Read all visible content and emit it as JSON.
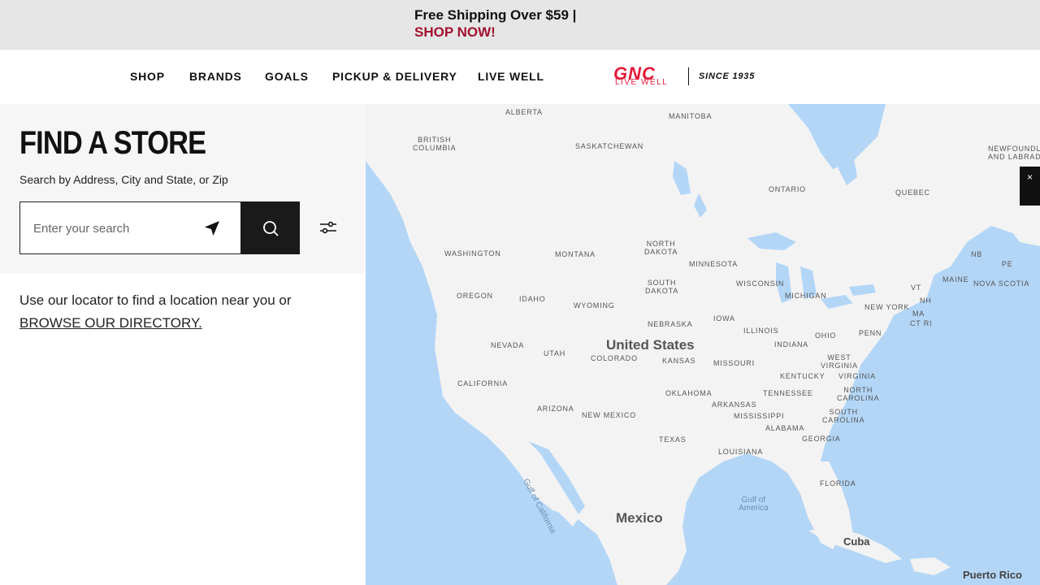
{
  "promo": {
    "line1": "Free Shipping Over $59 |",
    "line2": "SHOP NOW!"
  },
  "nav": {
    "items": [
      "SHOP",
      "BRANDS",
      "GOALS",
      "PICKUP & DELIVERY",
      "LIVE WELL"
    ]
  },
  "logo": {
    "brand": "GNC",
    "tagline": "LIVE WELL",
    "since": "SINCE 1935"
  },
  "find_store": {
    "title": "FIND A STORE",
    "subtitle": "Search by Address, City and State, or Zip",
    "search_placeholder": "Enter your search",
    "locator_text": "Use our locator to find a location near you or",
    "browse_link": "BROWSE OUR DIRECTORY."
  },
  "icons": {
    "locate": "navigation-arrow-icon",
    "search": "search-icon",
    "filter": "sliders-filter-icon",
    "close": "close-icon"
  },
  "colors": {
    "brand_red": "#e31837",
    "promo_red": "#a3112e",
    "map_water": "#b3d6f7",
    "map_land": "#f3f3f3"
  },
  "map": {
    "close_label": "×",
    "countries": {
      "us": "United States",
      "mexico": "Mexico",
      "cuba": "Cuba",
      "puerto_rico": "Puerto Rico"
    },
    "water": {
      "gulf_mexico": "Gulf of\nAmerica",
      "gulf_california": "Gulf of California"
    },
    "provinces": {
      "alberta": "ALBERTA",
      "manitoba": "MANITOBA",
      "british_columbia": "BRITISH\nCOLUMBIA",
      "saskatchewan": "SASKATCHEWAN",
      "ontario": "ONTARIO",
      "quebec": "QUEBEC",
      "newfoundland": "NEWFOUNDL\nAND LABRAD",
      "nb": "NB",
      "pe": "PE",
      "nova_scotia": "NOVA SCOTIA"
    },
    "states": {
      "washington": "WASHINGTON",
      "montana": "MONTANA",
      "north_dakota": "NORTH\nDAKOTA",
      "minnesota": "MINNESOTA",
      "oregon": "OREGON",
      "idaho": "IDAHO",
      "wyoming": "WYOMING",
      "south_dakota": "SOUTH\nDAKOTA",
      "wisconsin": "WISCONSIN",
      "michigan": "MICHIGAN",
      "nebraska": "NEBRASKA",
      "iowa": "IOWA",
      "illinois": "ILLINOIS",
      "ohio": "OHIO",
      "penn": "PENN",
      "new_york": "NEW YORK",
      "maine": "MAINE",
      "vt": "VT",
      "nh": "NH",
      "ma": "MA",
      "ct_ri": "CT RI",
      "nevada": "NEVADA",
      "utah": "UTAH",
      "colorado": "COLORADO",
      "kansas": "KANSAS",
      "missouri": "MISSOURI",
      "indiana": "INDIANA",
      "west_virginia": "WEST\nVIRGINIA",
      "kentucky": "KENTUCKY",
      "virginia": "VIRGINIA",
      "california": "CALIFORNIA",
      "arizona": "ARIZONA",
      "new_mexico": "NEW MEXICO",
      "oklahoma": "OKLAHOMA",
      "arkansas": "ARKANSAS",
      "tennessee": "TENNESSEE",
      "north_carolina": "NORTH\nCAROLINA",
      "mississippi": "MISSISSIPPI",
      "alabama": "ALABAMA",
      "south_carolina": "SOUTH\nCAROLINA",
      "georgia": "GEORGIA",
      "texas": "TEXAS",
      "louisiana": "LOUISIANA",
      "florida": "FLORIDA"
    }
  }
}
